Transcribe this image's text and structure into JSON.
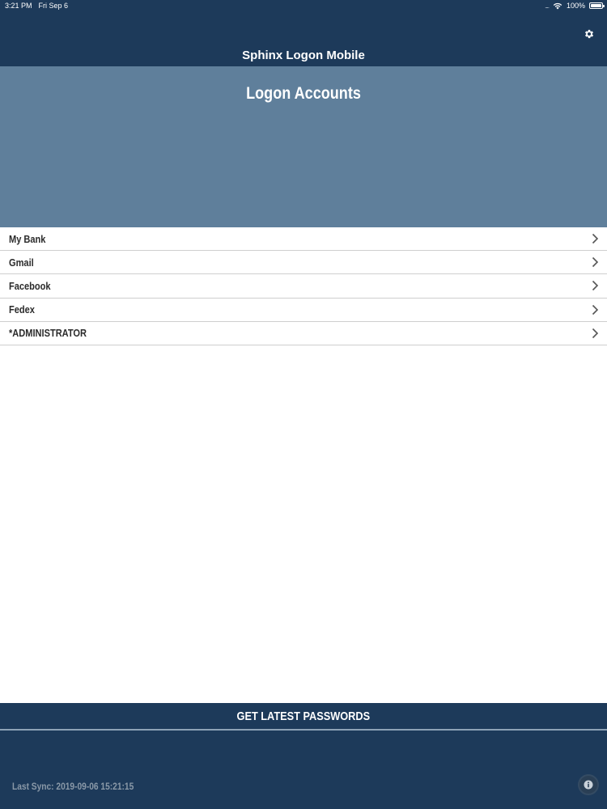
{
  "status_bar": {
    "time": "3:21 PM",
    "date": "Fri Sep 6",
    "battery": "100%",
    "signal": "....",
    "icons": [
      "wifi-icon",
      "battery-icon"
    ]
  },
  "header": {
    "title": "Sphinx Logon Mobile",
    "settings_icon": "gear-icon"
  },
  "hero": {
    "title": "Logon Accounts"
  },
  "accounts": [
    {
      "label": "My Bank"
    },
    {
      "label": "Gmail"
    },
    {
      "label": "Facebook"
    },
    {
      "label": "Fedex"
    },
    {
      "label": "*ADMINISTRATOR"
    }
  ],
  "footer": {
    "action_label": "GET LATEST PASSWORDS",
    "last_sync": "Last Sync: 2019-09-06 15:21:15",
    "info_icon": "info-icon"
  },
  "colors": {
    "header_bg": "#1d3a5a",
    "hero_bg": "#5f7f9b",
    "row_divider": "#cfcfcf",
    "text_dark": "#2b2b2b",
    "muted_text": "#8a99a8"
  }
}
